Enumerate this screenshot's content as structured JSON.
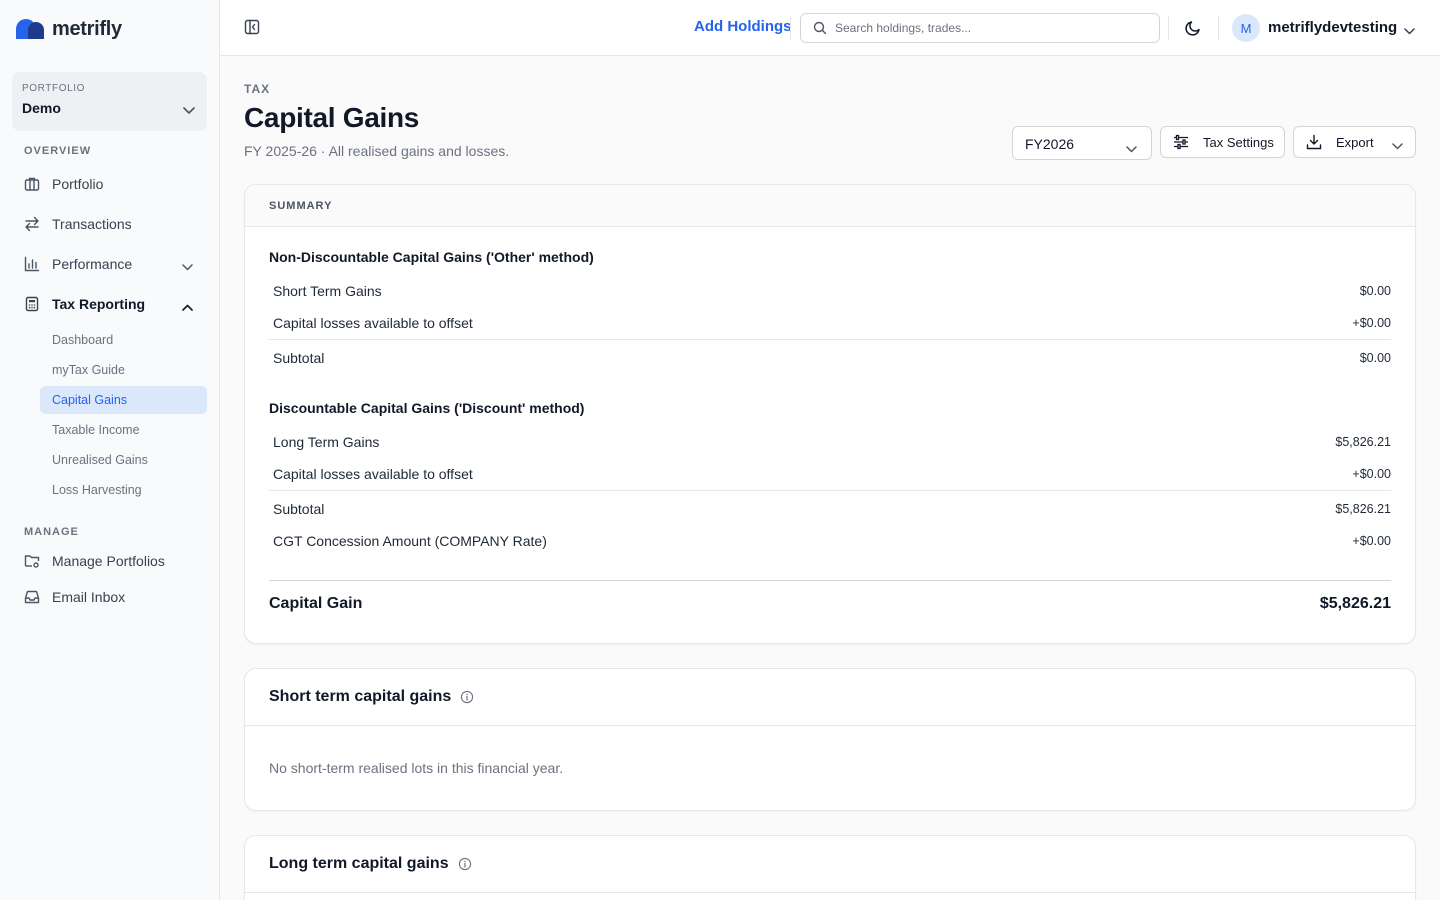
{
  "app": {
    "name": "metrifly",
    "brand_color": "#2563eb"
  },
  "sidebar": {
    "portfolio_label": "PORTFOLIO",
    "portfolio_name": "Demo",
    "overview_label": "OVERVIEW",
    "manage_label": "MANAGE",
    "items": [
      {
        "label": "Portfolio",
        "icon": "briefcase-icon"
      },
      {
        "label": "Transactions",
        "icon": "arrows-swap-icon"
      },
      {
        "label": "Performance",
        "icon": "bar-chart-icon"
      },
      {
        "label": "Tax Reporting",
        "icon": "calculator-icon"
      }
    ],
    "tax_sub_items": [
      {
        "label": "Dashboard"
      },
      {
        "label": "myTax Guide"
      },
      {
        "label": "Capital Gains",
        "active": true
      },
      {
        "label": "Taxable Income"
      },
      {
        "label": "Unrealised Gains"
      },
      {
        "label": "Loss Harvesting"
      }
    ],
    "manage_items": [
      {
        "label": "Manage Portfolios",
        "icon": "folder-settings-icon"
      },
      {
        "label": "Email Inbox",
        "icon": "inbox-icon"
      }
    ]
  },
  "topbar": {
    "add_holdings": "Add Holdings",
    "search_placeholder": "Search holdings, trades...",
    "avatar_initial": "M",
    "username": "metriflydevtesting"
  },
  "page": {
    "eyebrow": "TAX",
    "title": "Capital Gains",
    "subtitle": "FY 2025-26 · All realised gains and losses.",
    "fy_selected": "FY2026",
    "tax_settings": "Tax Settings",
    "export": "Export"
  },
  "summary": {
    "header": "SUMMARY",
    "non_discount": {
      "title": "Non-Discountable Capital Gains ('Other' method)",
      "rows": [
        {
          "label": "Short Term Gains",
          "value": "$0.00"
        },
        {
          "label": "Capital losses available to offset",
          "value": "+$0.00"
        },
        {
          "label": "Subtotal",
          "value": "$0.00"
        }
      ]
    },
    "discount": {
      "title": "Discountable Capital Gains ('Discount' method)",
      "rows": [
        {
          "label": "Long Term Gains",
          "value": "$5,826.21"
        },
        {
          "label": "Capital losses available to offset",
          "value": "+$0.00"
        },
        {
          "label": "Subtotal",
          "value": "$5,826.21"
        },
        {
          "label": "CGT Concession Amount (COMPANY Rate)",
          "value": "+$0.00"
        }
      ]
    },
    "total_label": "Capital Gain",
    "total_value": "$5,826.21"
  },
  "short_term": {
    "title": "Short term capital gains",
    "empty": "No short-term realised lots in this financial year."
  },
  "long_term": {
    "title": "Long term capital gains"
  }
}
